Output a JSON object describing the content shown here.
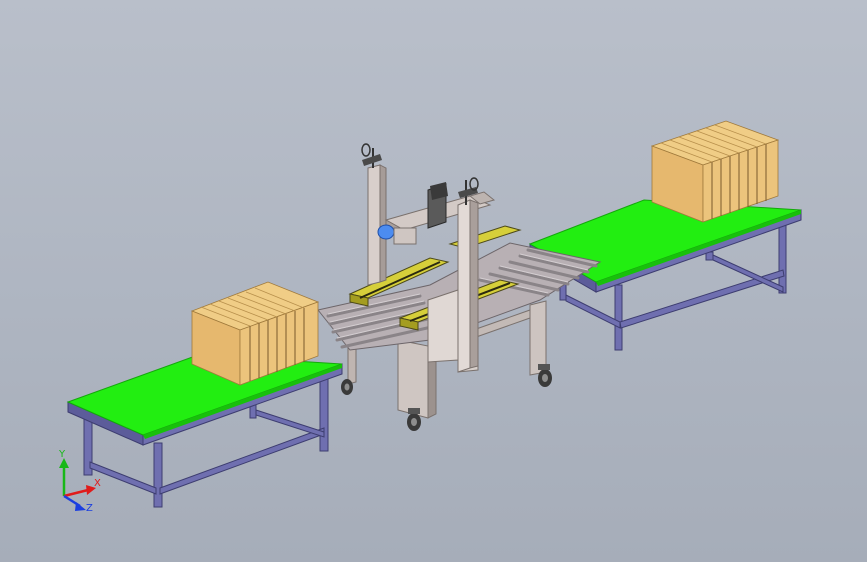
{
  "viewport": {
    "background_top": "#b9bfca",
    "background_bottom": "#a6adb9"
  },
  "colors": {
    "belt": "#22ee11",
    "belt_edge": "#14a80c",
    "frame": "#6f6fb0",
    "frame_dark": "#4b4b86",
    "box": "#e8c07a",
    "box_dark": "#c99a52",
    "machine": "#c8beb9",
    "machine_dark": "#8f8580",
    "roller": "#a6a2a8",
    "tape_head": "#d6cf3a",
    "tape_dark": "#4d4a18",
    "blue_part": "#4c8cf0",
    "axis_x": "#e01b1b",
    "axis_y": "#18b818",
    "axis_z": "#1b3ee0"
  },
  "triad": {
    "x_label": "X",
    "y_label": "Y",
    "z_label": "Z",
    "icon": "coordinate-triad-icon"
  },
  "model": {
    "parts": [
      "infeed-belt-conveyor",
      "carton-stack-infeed",
      "case-sealer-machine",
      "roller-conveyor",
      "outfeed-belt-conveyor",
      "carton-stack-outfeed"
    ]
  }
}
